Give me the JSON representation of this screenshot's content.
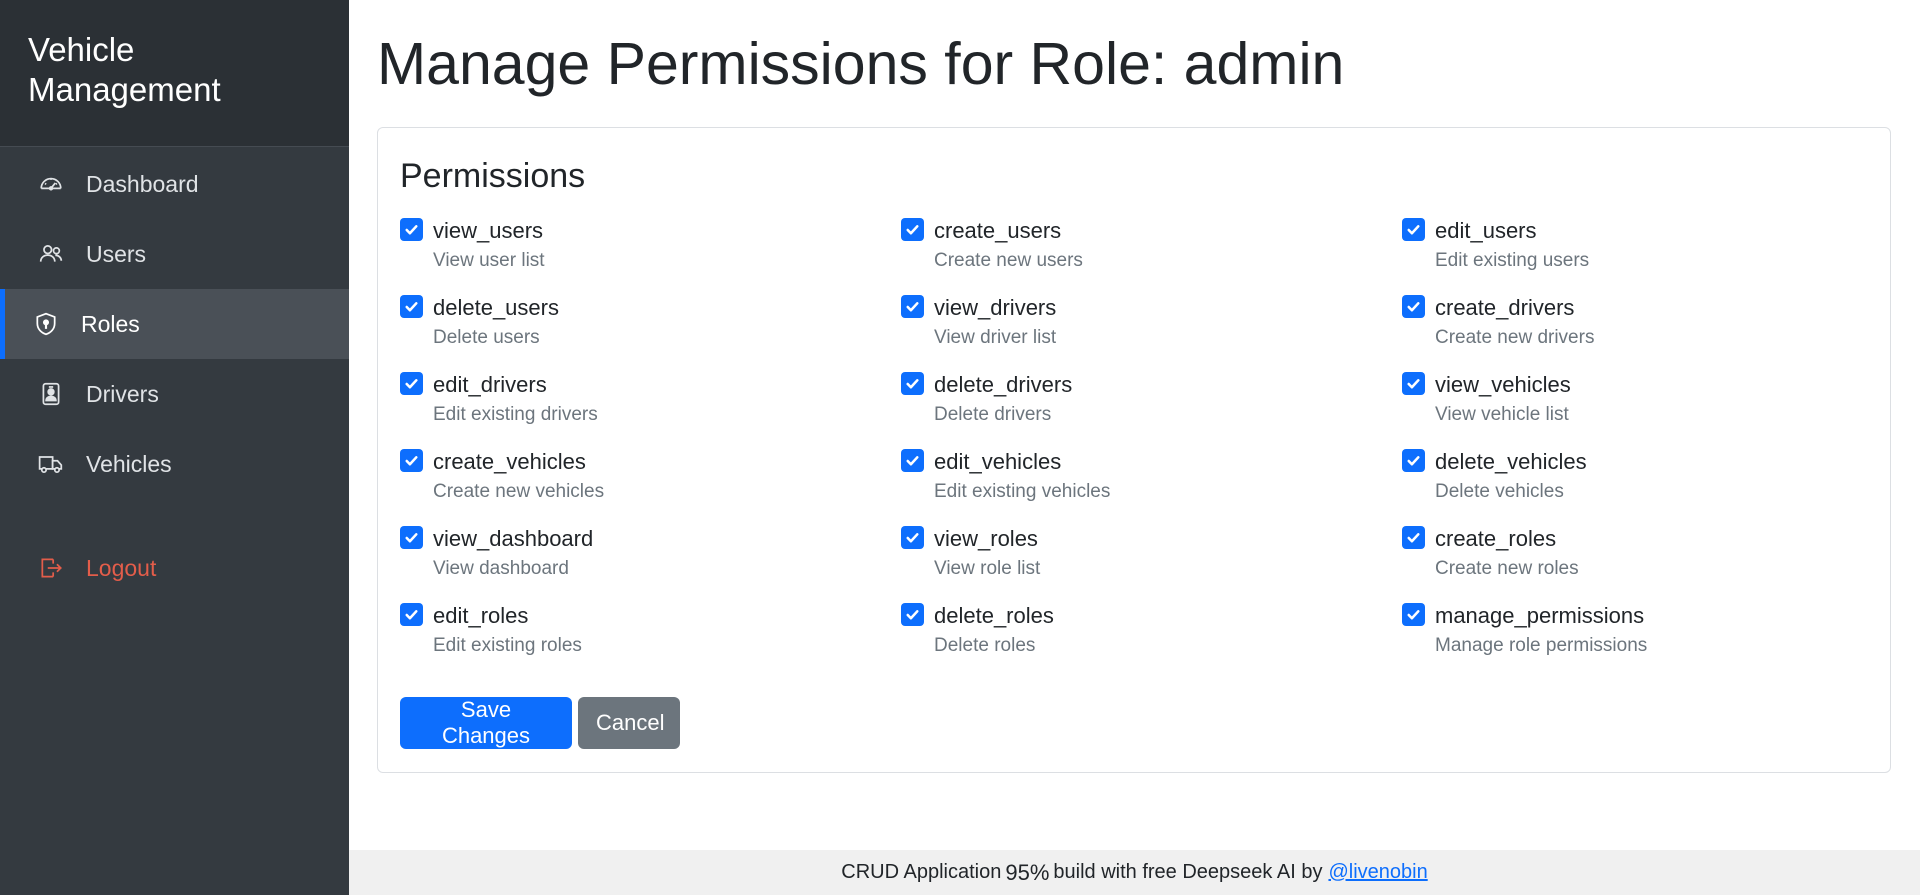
{
  "sidebar": {
    "brand_line1": "Vehicle",
    "brand_line2": "Management",
    "items": [
      {
        "label": "Dashboard",
        "icon": "speedometer-icon"
      },
      {
        "label": "Users",
        "icon": "users-icon"
      },
      {
        "label": "Roles",
        "icon": "shield-icon",
        "active": true
      },
      {
        "label": "Drivers",
        "icon": "badge-icon"
      },
      {
        "label": "Vehicles",
        "icon": "truck-icon"
      }
    ],
    "logout_label": "Logout"
  },
  "page": {
    "title": "Manage Permissions for Role: admin"
  },
  "card": {
    "title": "Permissions",
    "permissions": [
      {
        "name": "view_users",
        "description": "View user list",
        "checked": true
      },
      {
        "name": "create_users",
        "description": "Create new users",
        "checked": true
      },
      {
        "name": "edit_users",
        "description": "Edit existing users",
        "checked": true
      },
      {
        "name": "delete_users",
        "description": "Delete users",
        "checked": true
      },
      {
        "name": "view_drivers",
        "description": "View driver list",
        "checked": true
      },
      {
        "name": "create_drivers",
        "description": "Create new drivers",
        "checked": true
      },
      {
        "name": "edit_drivers",
        "description": "Edit existing drivers",
        "checked": true
      },
      {
        "name": "delete_drivers",
        "description": "Delete drivers",
        "checked": true
      },
      {
        "name": "view_vehicles",
        "description": "View vehicle list",
        "checked": true
      },
      {
        "name": "create_vehicles",
        "description": "Create new vehicles",
        "checked": true
      },
      {
        "name": "edit_vehicles",
        "description": "Edit existing vehicles",
        "checked": true
      },
      {
        "name": "delete_vehicles",
        "description": "Delete vehicles",
        "checked": true
      },
      {
        "name": "view_dashboard",
        "description": "View dashboard",
        "checked": true
      },
      {
        "name": "view_roles",
        "description": "View role list",
        "checked": true
      },
      {
        "name": "create_roles",
        "description": "Create new roles",
        "checked": true
      },
      {
        "name": "edit_roles",
        "description": "Edit existing roles",
        "checked": true
      },
      {
        "name": "delete_roles",
        "description": "Delete roles",
        "checked": true
      },
      {
        "name": "manage_permissions",
        "description": "Manage role permissions",
        "checked": true
      }
    ],
    "save_label": "Save Changes",
    "cancel_label": "Cancel"
  },
  "footer": {
    "text_before": "CRUD Application",
    "percent": "95%",
    "text_after": "build with free Deepseek AI by",
    "link_text": "@livenobin"
  },
  "colors": {
    "sidebar_bg": "#343a40",
    "accent": "#0d6efd",
    "logout": "#e35d4a",
    "secondary": "#6c757d"
  }
}
